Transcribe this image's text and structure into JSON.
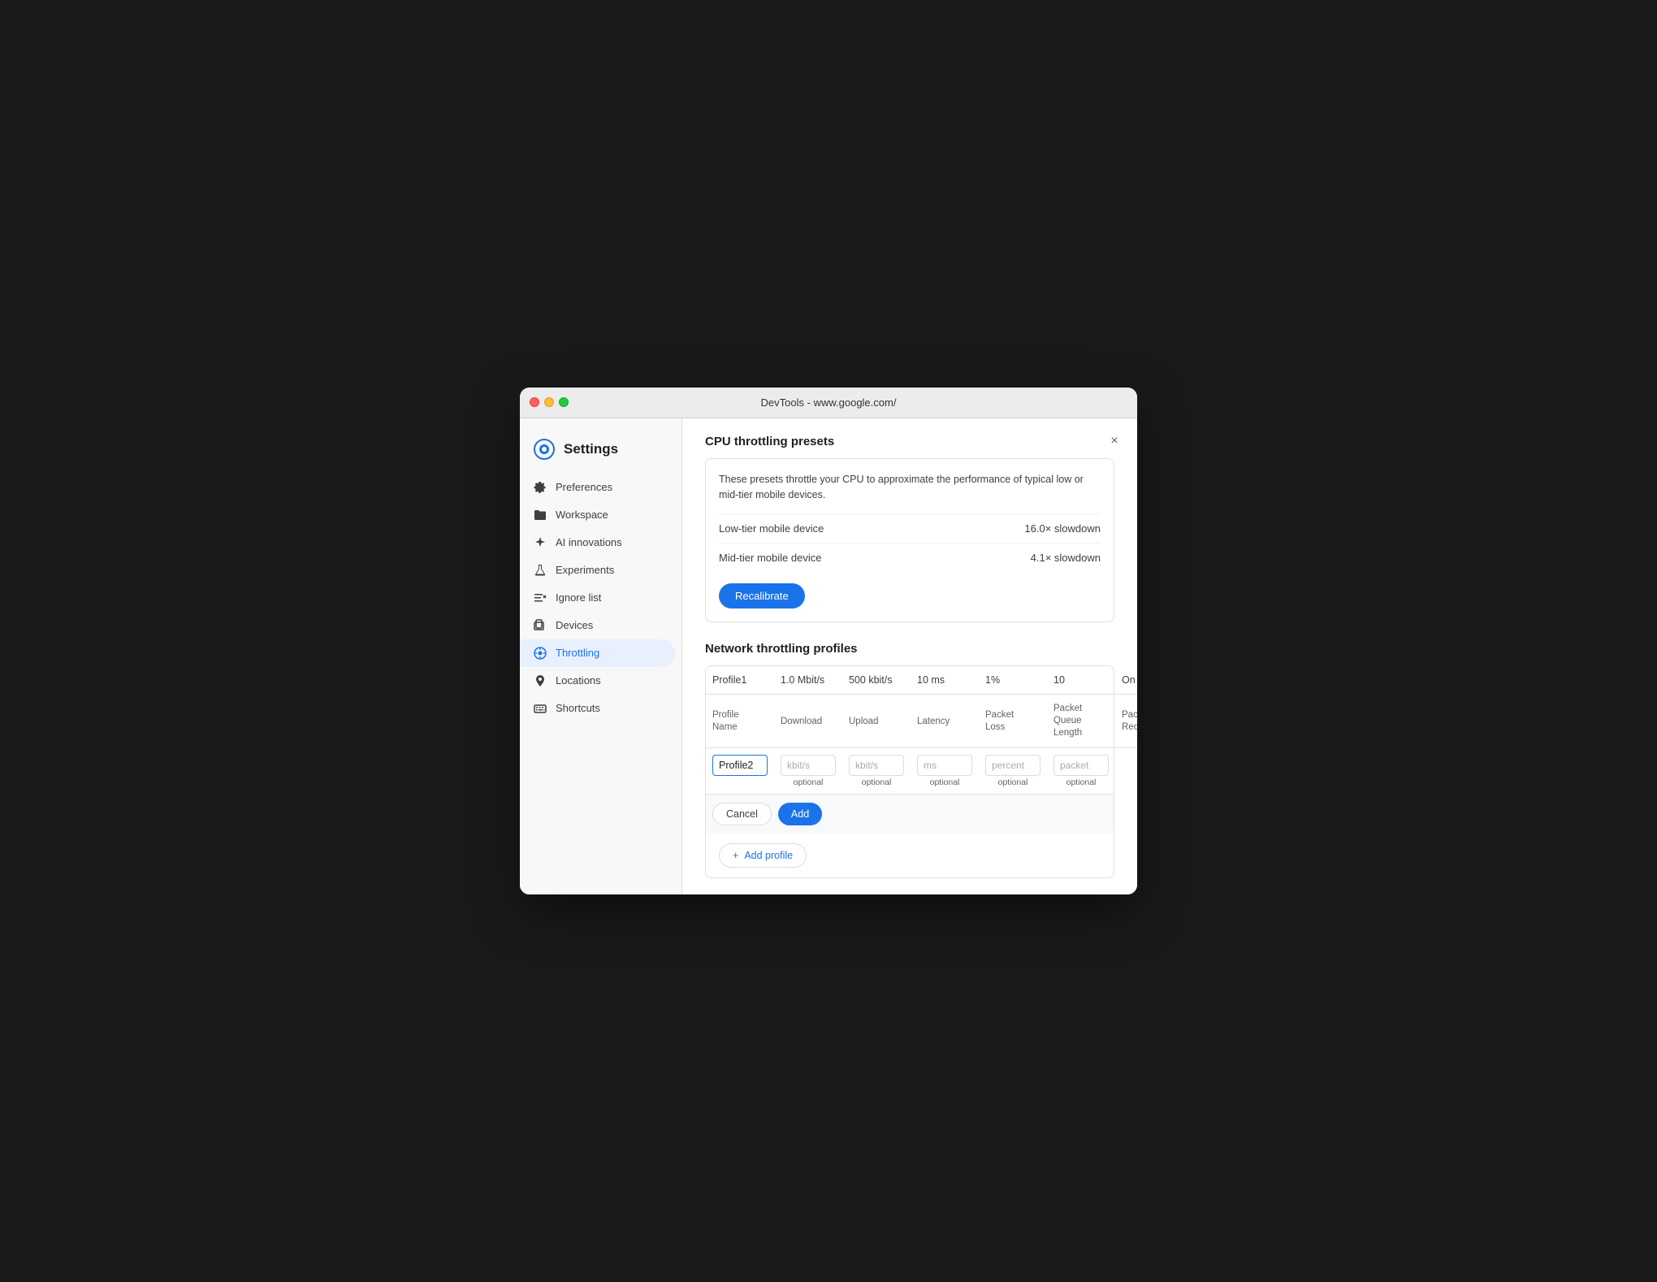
{
  "window": {
    "titlebar": "DevTools - www.google.com/"
  },
  "sidebar": {
    "heading": "Settings",
    "items": [
      {
        "id": "preferences",
        "label": "Preferences",
        "icon": "gear"
      },
      {
        "id": "workspace",
        "label": "Workspace",
        "icon": "folder"
      },
      {
        "id": "ai-innovations",
        "label": "AI innovations",
        "icon": "sparkle"
      },
      {
        "id": "experiments",
        "label": "Experiments",
        "icon": "flask"
      },
      {
        "id": "ignore-list",
        "label": "Ignore list",
        "icon": "list-x"
      },
      {
        "id": "devices",
        "label": "Devices",
        "icon": "device"
      },
      {
        "id": "throttling",
        "label": "Throttling",
        "icon": "circle-dots",
        "active": true
      },
      {
        "id": "locations",
        "label": "Locations",
        "icon": "location"
      },
      {
        "id": "shortcuts",
        "label": "Shortcuts",
        "icon": "keyboard"
      }
    ]
  },
  "main": {
    "cpu_section": {
      "title": "CPU throttling presets",
      "description": "These presets throttle your CPU to approximate the performance of typical low or mid-tier mobile devices.",
      "presets": [
        {
          "name": "Low-tier mobile device",
          "value": "16.0× slowdown"
        },
        {
          "name": "Mid-tier mobile device",
          "value": "4.1× slowdown"
        }
      ],
      "recalibrate_label": "Recalibrate"
    },
    "network_section": {
      "title": "Network throttling profiles",
      "table": {
        "existing_profile": {
          "name": "Profile1",
          "download": "1.0 Mbit/s",
          "upload": "500 kbit/s",
          "latency": "10 ms",
          "packet_loss": "1%",
          "packet_queue": "10",
          "packet_reordering": "On"
        },
        "columns": [
          {
            "label": "Profile\nName"
          },
          {
            "label": "Download"
          },
          {
            "label": "Upload"
          },
          {
            "label": "Latency"
          },
          {
            "label": "Packet\nLoss"
          },
          {
            "label": "Packet\nQueue\nLength"
          },
          {
            "label": "Packet\nReordering"
          }
        ],
        "new_row": {
          "name_value": "Profile2",
          "download_placeholder": "kbit/s",
          "upload_placeholder": "kbit/s",
          "latency_placeholder": "ms",
          "loss_placeholder": "percent",
          "queue_placeholder": "packet",
          "download_hint": "optional",
          "upload_hint": "optional",
          "latency_hint": "optional",
          "loss_hint": "optional",
          "queue_hint": "optional"
        }
      },
      "cancel_label": "Cancel",
      "add_label": "Add",
      "add_profile_label": "+ Add profile"
    }
  },
  "close_button": "×"
}
